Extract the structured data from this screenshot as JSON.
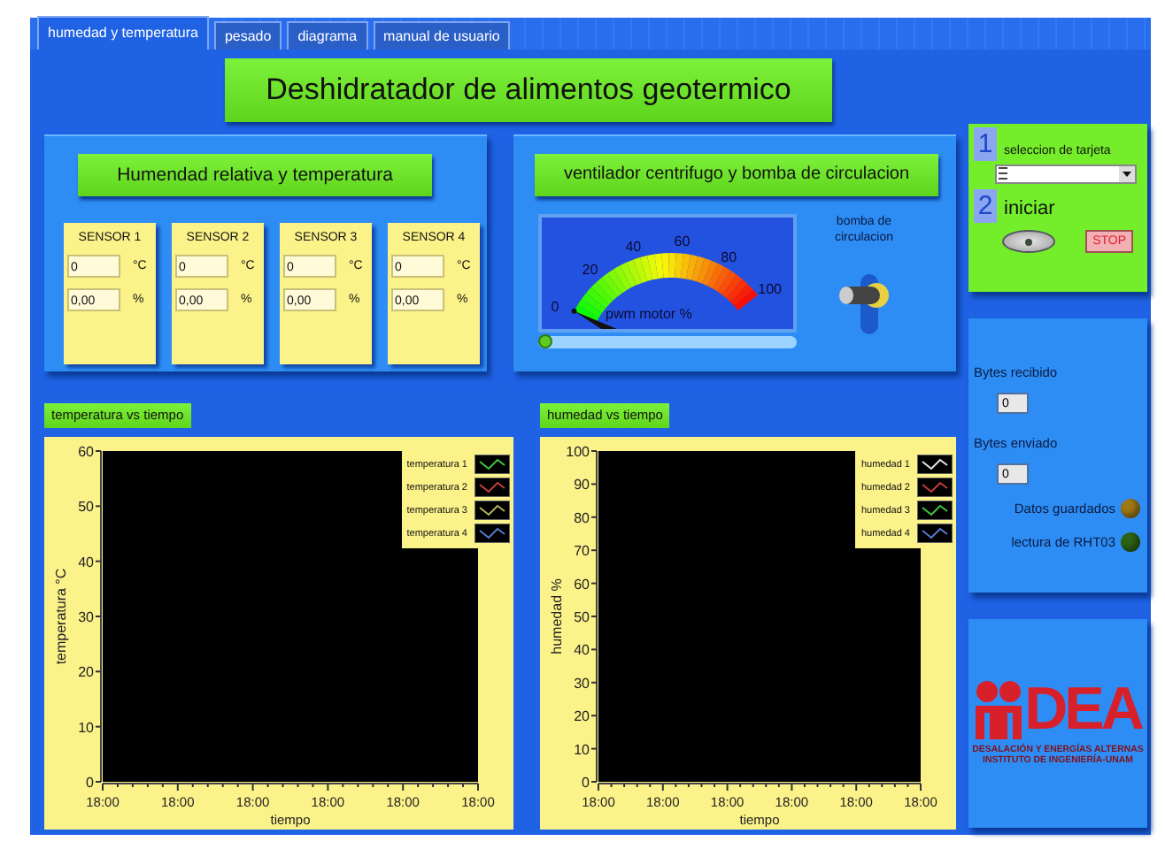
{
  "tabs": [
    {
      "label": "humedad y temperatura",
      "selected": true
    },
    {
      "label": "pesado",
      "selected": false
    },
    {
      "label": "diagrama",
      "selected": false
    },
    {
      "label": "manual de usuario",
      "selected": false
    }
  ],
  "title": "Deshidratador de alimentos geotermico",
  "sensor_panel": {
    "heading": "Humendad relativa y temperatura",
    "sensors": [
      {
        "name": "SENSOR 1",
        "temperature": "0",
        "temperature_unit": "°C",
        "humidity": "0,00",
        "humidity_unit": "%"
      },
      {
        "name": "SENSOR 2",
        "temperature": "0",
        "temperature_unit": "°C",
        "humidity": "0,00",
        "humidity_unit": "%"
      },
      {
        "name": "SENSOR 3",
        "temperature": "0",
        "temperature_unit": "°C",
        "humidity": "0,00",
        "humidity_unit": "%"
      },
      {
        "name": "SENSOR 4",
        "temperature": "0",
        "temperature_unit": "°C",
        "humidity": "0,00",
        "humidity_unit": "%"
      }
    ]
  },
  "fan_panel": {
    "heading": "ventilador centrifugo y bomba de circulacion",
    "meter": {
      "label": "pwm motor  %",
      "ticks": [
        "0",
        "20",
        "40",
        "60",
        "80",
        "100"
      ],
      "level": 0
    },
    "slider": {
      "level": 0
    },
    "pump_switch": {
      "label": "bomba de circulacion",
      "on": false
    }
  },
  "charts": [
    {
      "heading": "temperatura vs tiempo",
      "chart_data": {
        "type": "line",
        "xlabel": "tiempo",
        "ylabel": "temperatura °C",
        "ylim": [
          0,
          60
        ],
        "yticks": [
          0,
          10,
          20,
          30,
          40,
          50,
          60
        ],
        "categories": [
          "18:00",
          "18:00",
          "18:00",
          "18:00",
          "18:00",
          "18:00"
        ],
        "series": [
          {
            "name": "temperatura 1",
            "color": "#3cc83c",
            "values": [
              null,
              null,
              null,
              null,
              null,
              null
            ]
          },
          {
            "name": "temperatura 2",
            "color": "#c83c3c",
            "values": [
              null,
              null,
              null,
              null,
              null,
              null
            ]
          },
          {
            "name": "temperatura 3",
            "color": "#b4b45a",
            "values": [
              null,
              null,
              null,
              null,
              null,
              null
            ]
          },
          {
            "name": "temperatura 4",
            "color": "#5a7ad2",
            "values": [
              null,
              null,
              null,
              null,
              null,
              null
            ]
          }
        ]
      }
    },
    {
      "heading": "humedad vs tiempo",
      "chart_data": {
        "type": "line",
        "xlabel": "tiempo",
        "ylabel": "humedad %",
        "ylim": [
          0,
          100
        ],
        "yticks": [
          0,
          10,
          20,
          30,
          40,
          50,
          60,
          70,
          80,
          90,
          100
        ],
        "categories": [
          "18:00",
          "18:00",
          "18:00",
          "18:00",
          "18:00",
          "18:00"
        ],
        "series": [
          {
            "name": "humedad 1",
            "color": "#e6e6e6",
            "values": [
              null,
              null,
              null,
              null,
              null,
              null
            ]
          },
          {
            "name": "humedad 2",
            "color": "#c83c3c",
            "values": [
              null,
              null,
              null,
              null,
              null,
              null
            ]
          },
          {
            "name": "humedad 3",
            "color": "#3cc83c",
            "values": [
              null,
              null,
              null,
              null,
              null,
              null
            ]
          },
          {
            "name": "humedad 4",
            "color": "#5a7ad2",
            "values": [
              null,
              null,
              null,
              null,
              null,
              null
            ]
          }
        ]
      }
    }
  ],
  "setup_card": {
    "steps": [
      {
        "number": "1",
        "label": "seleccion de tarjeta"
      },
      {
        "number": "2",
        "label": "iniciar"
      }
    ],
    "start_button": {
      "on": false
    },
    "stop_button": "STOP"
  },
  "status_card": {
    "counters": [
      {
        "label": "Bytes recibido",
        "value": "0"
      },
      {
        "label": "Bytes enviado",
        "value": "0"
      }
    ],
    "indicators": [
      {
        "label": "Datos guardados",
        "on": false,
        "color": "#a07814"
      },
      {
        "label": "lectura  de RHT03",
        "on": false,
        "color": "#2e6414"
      }
    ]
  },
  "logo": {
    "mark": "DEA",
    "lines": [
      "DESALACIÓN Y ENERGÍAS ALTERNAS",
      "INSTITUTO DE INGENIERÍA-UNAM"
    ]
  }
}
